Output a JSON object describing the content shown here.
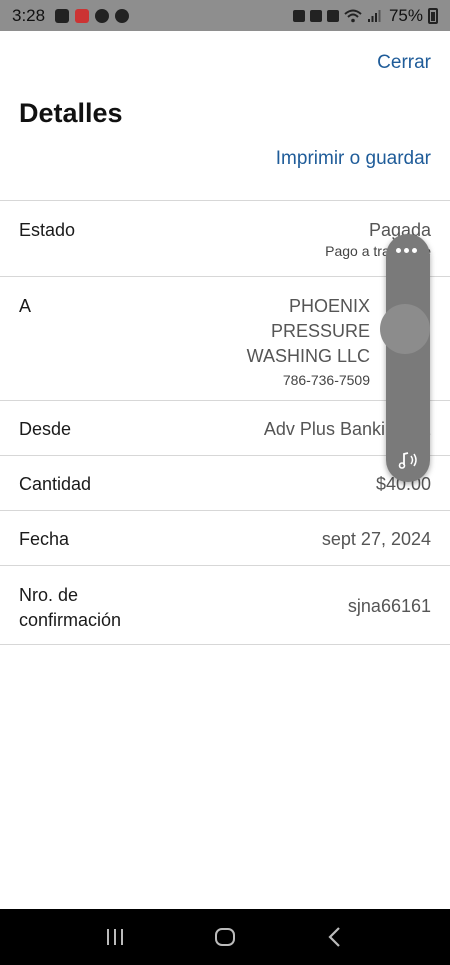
{
  "status_bar": {
    "time": "3:28",
    "battery": "75%"
  },
  "header": {
    "close_label": "Cerrar",
    "title": "Detalles",
    "print_label": "Imprimir o guardar"
  },
  "details": {
    "status": {
      "label": "Estado",
      "value": "Pagada",
      "sub": "Pago a través de"
    },
    "to": {
      "label": "A",
      "name_line1": "PHOENIX",
      "name_line2": "PRESSURE",
      "name_line3": "WASHING LLC",
      "phone": "786-736-7509"
    },
    "from": {
      "label": "Desde",
      "value": "Adv Plus Banking - 2"
    },
    "amount": {
      "label": "Cantidad",
      "value": "$40.00"
    },
    "date": {
      "label": "Fecha",
      "value": "sept 27, 2024"
    },
    "confirmation": {
      "label_line1": "Nro. de",
      "label_line2": "confirmación",
      "value": "sjna66161"
    }
  },
  "overlay": {
    "menu_icon": "more-dots-icon",
    "audio_icon": "audio-note-icon"
  },
  "nav": {
    "recents_icon": "recents-icon",
    "home_icon": "home-icon",
    "back_icon": "back-icon"
  }
}
